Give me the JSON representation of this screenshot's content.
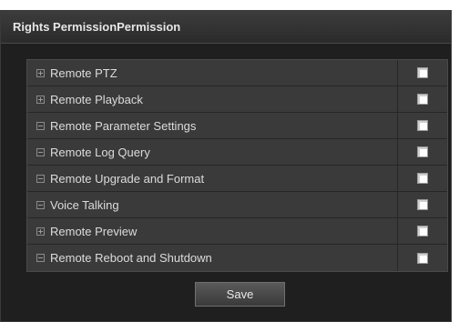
{
  "panel": {
    "title": "Rights PermissionPermission"
  },
  "permissions": [
    {
      "label": "Remote PTZ",
      "toggle": "plus",
      "checked": true
    },
    {
      "label": "Remote Playback",
      "toggle": "plus",
      "checked": true
    },
    {
      "label": "Remote Parameter Settings",
      "toggle": "minus",
      "checked": true
    },
    {
      "label": "Remote Log Query",
      "toggle": "minus",
      "checked": true
    },
    {
      "label": "Remote Upgrade and Format",
      "toggle": "minus",
      "checked": true
    },
    {
      "label": "Voice Talking",
      "toggle": "minus",
      "checked": true
    },
    {
      "label": "Remote Preview",
      "toggle": "plus",
      "checked": true
    },
    {
      "label": "Remote Reboot and Shutdown",
      "toggle": "minus",
      "checked": true
    }
  ],
  "actions": {
    "save_label": "Save"
  }
}
